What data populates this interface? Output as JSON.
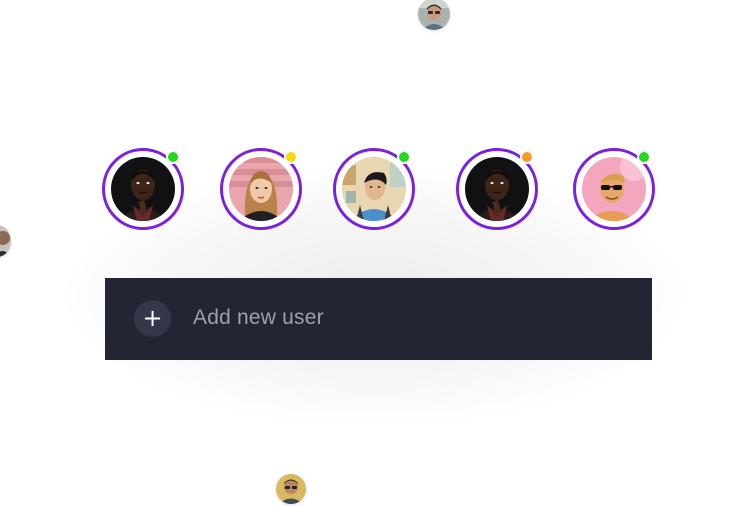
{
  "colors": {
    "ring": "#7b1fe0",
    "online": "#22d81e",
    "away": "#f5d90a",
    "busy": "#ff9a1f",
    "bar_background": "#232534",
    "add_button_background": "#343748",
    "label_text": "#9fa0aa"
  },
  "avatars": [
    {
      "name": "avatar-1",
      "status": "online",
      "status_color": "#22d81e"
    },
    {
      "name": "avatar-2",
      "status": "away",
      "status_color": "#f5d90a"
    },
    {
      "name": "avatar-3",
      "status": "online",
      "status_color": "#22d81e"
    },
    {
      "name": "avatar-4",
      "status": "busy",
      "status_color": "#ff9a1f"
    },
    {
      "name": "avatar-5",
      "status": "online",
      "status_color": "#22d81e"
    }
  ],
  "add_user": {
    "icon": "plus-icon",
    "icon_glyph": "+",
    "label": "Add new user"
  }
}
